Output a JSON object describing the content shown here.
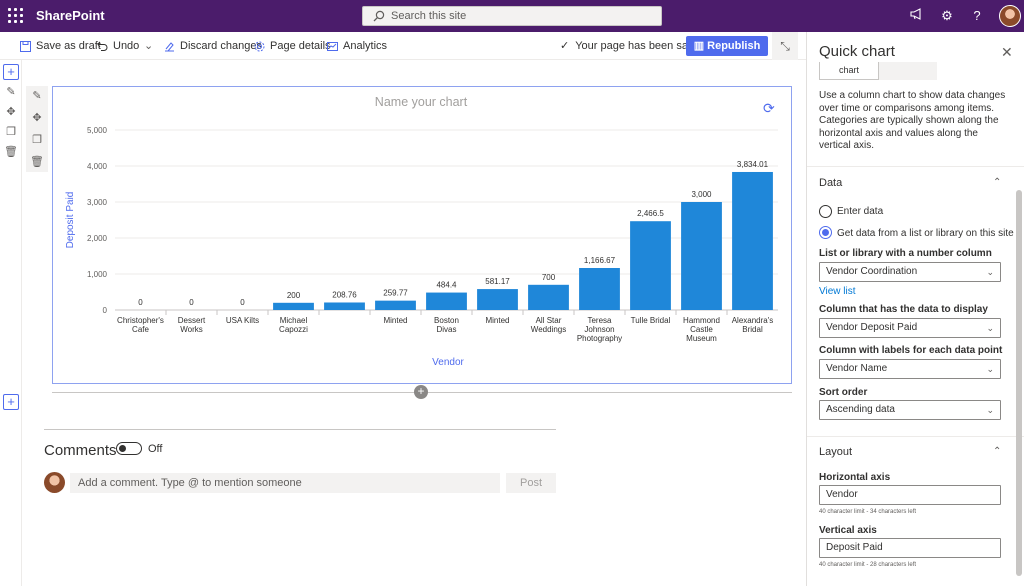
{
  "suite": {
    "brand": "SharePoint",
    "search_placeholder": "Search this site"
  },
  "toolbar": {
    "save_draft": "Save as draft",
    "undo": "Undo",
    "discard": "Discard changes",
    "page_details": "Page details",
    "analytics": "Analytics",
    "saved_status": "Your page has been saved",
    "republish": "Republish"
  },
  "comments": {
    "title": "Comments",
    "toggle_label": "Off",
    "placeholder": "Add a comment. Type @ to mention someone",
    "post": "Post"
  },
  "panel": {
    "title": "Quick chart",
    "chip_label": "chart",
    "description": "Use a column chart to show data changes over time or comparisons among items. Categories are typically shown along the horizontal axis and values along the vertical axis.",
    "data_section": "Data",
    "radio_enter": "Enter data",
    "radio_list": "Get data from a list or library on this site",
    "list_label": "List or library with a number column",
    "list_value": "Vendor Coordination",
    "view_list": "View list",
    "column_label": "Column that has the data to display",
    "column_value": "Vendor Deposit Paid",
    "labels_label": "Column with labels for each data point",
    "labels_value": "Vendor Name",
    "sort_label": "Sort order",
    "sort_value": "Ascending data",
    "layout_section": "Layout",
    "haxis_label": "Horizontal axis",
    "haxis_value": "Vendor",
    "haxis_hint": "40 character limit - 34 characters left",
    "vaxis_label": "Vertical axis",
    "vaxis_value": "Deposit Paid",
    "vaxis_hint": "40 character limit - 28 characters left"
  },
  "colors": {
    "bar": "#1f87d9",
    "accent": "#4f6bed",
    "suite": "#4b1c6b"
  },
  "chart_data": {
    "type": "bar",
    "title": "Name your chart",
    "xlabel": "Vendor",
    "ylabel": "Deposit Paid",
    "ylim": [
      0,
      5000
    ],
    "yticks": [
      "0",
      "1,000",
      "2,000",
      "3,000",
      "4,000",
      "5,000"
    ],
    "grid": true,
    "categories": [
      [
        "Christopher's",
        "Cafe"
      ],
      [
        "Dessert",
        "Works"
      ],
      [
        "USA Kilts"
      ],
      [
        "Michael",
        "Capozzi"
      ],
      [],
      [
        "Minted"
      ],
      [
        "Boston",
        "Divas"
      ],
      [
        "Minted"
      ],
      [
        "All Star",
        "Weddings"
      ],
      [
        "Teresa",
        "Johnson",
        "Photography"
      ],
      [
        "Tulle Bridal"
      ],
      [
        "Hammond",
        "Castle",
        "Museum"
      ],
      [
        "Alexandra's",
        "Bridal"
      ]
    ],
    "values": [
      0,
      0,
      0,
      200,
      208.76,
      259.77,
      484.4,
      581.17,
      700,
      1166.67,
      2466.5,
      3000,
      3834.01
    ],
    "value_labels": [
      "0",
      "0",
      "0",
      "200",
      "208.76",
      "259.77",
      "484.4",
      "581.17",
      "700",
      "1,166.67",
      "2,466.5",
      "3,000",
      "3,834.01"
    ]
  }
}
